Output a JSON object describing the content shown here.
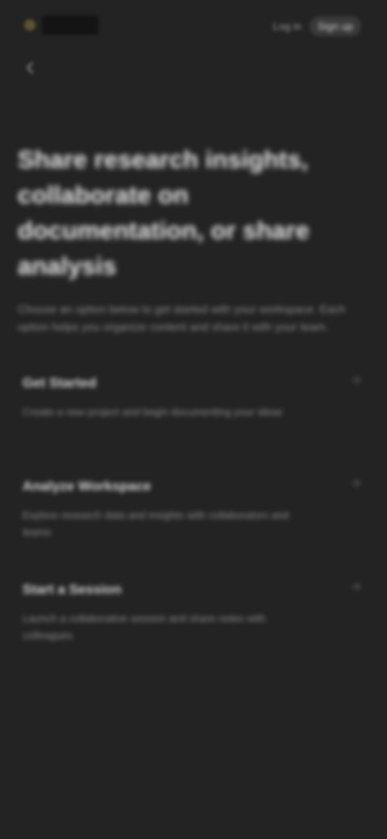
{
  "header": {
    "logo_icon": "brand-logo-icon",
    "secondary_link": "Log in",
    "primary_link": "Sign up"
  },
  "back": {
    "icon": "arrow-left-icon"
  },
  "hero": {
    "title": "Share research insights, collaborate on documentation, or share analysis",
    "subtitle": "Choose an option below to get started with your workspace. Each option helps you organize content and share it with your team."
  },
  "options": [
    {
      "title": "Get Started",
      "description": "Create a new project and begin documenting your ideas",
      "arrow_icon": "chevron-right-icon"
    },
    {
      "title": "Analyze Workspace",
      "description": "Explore research data and insights with collaborators and teams",
      "arrow_icon": "chevron-right-icon"
    },
    {
      "title": "Start a Session",
      "description": "Launch a collaborative session and share notes with colleagues",
      "arrow_icon": "chevron-right-icon"
    }
  ],
  "colors": {
    "background": "#232323",
    "accent": "#5e5434"
  }
}
